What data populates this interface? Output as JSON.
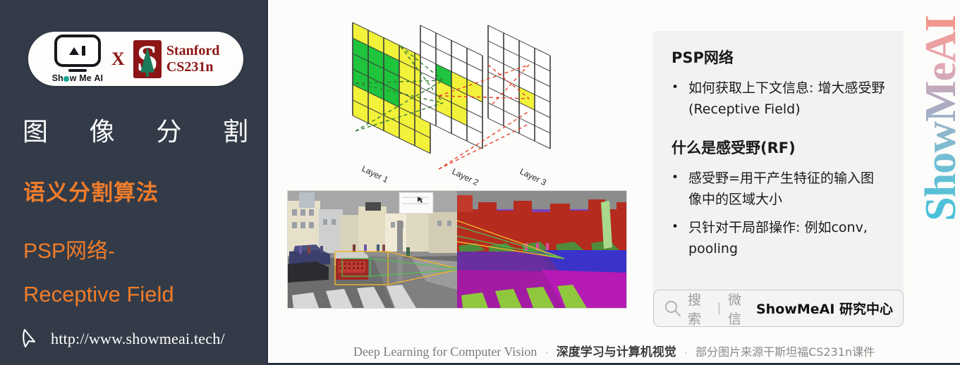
{
  "sidebar": {
    "logo": {
      "showmeai_label": "Show Me AI",
      "cross_label": "X",
      "stanford_line1": "Stanford",
      "stanford_line2": "CS231n",
      "stanford_mark_letter": "S"
    },
    "title_chars": [
      "图",
      "像",
      "分",
      "割"
    ],
    "subtitle_1": "语义分割算法",
    "subtitle_2": "PSP网络-",
    "subtitle_3": "Receptive Field",
    "url": "http://www.showmeai.tech/",
    "colors": {
      "background": "#333b48",
      "accent_orange": "#ef7c2a",
      "title_white": "#ffffff",
      "stanford_red": "#8c1515"
    }
  },
  "slide": {
    "diagram": {
      "layer_labels": [
        "Layer 1",
        "Layer 2",
        "Layer 3"
      ],
      "colors": {
        "green": "#1fc43c",
        "yellow": "#f2f23a",
        "grid_stroke": "#3a3a3a",
        "green_link": "#2e7d32",
        "red_link": "#e8402a"
      }
    },
    "photos": {
      "left_caption": "",
      "right_caption": "",
      "highlight_box_color": "#f0b429",
      "inner_box_color": "#4fc24f"
    },
    "notes": {
      "heading_1": "PSP网络",
      "bullets_1": [
        "如何获取上下文信息: 增大感受野(Receptive Field)"
      ],
      "heading_2": "什么是感受野(RF)",
      "bullets_2": [
        "感受野=用干产生特征的输入图像中的区域大小",
        "只针对干局部操作: 例如conv, pooling"
      ],
      "background": "#f2f2f2"
    },
    "watermark": "ShowMeAI",
    "searchbar": {
      "placeholder": "搜索",
      "divider": "|",
      "channel": "微信",
      "brand": "ShowMeAI 研究中心"
    },
    "caption": {
      "english": "Deep Learning for Computer Vision",
      "sep": "·",
      "chinese_bold": "深度学习与计算机视觉",
      "tail": "部分图片来源干斯坦福CS231n课件"
    }
  }
}
